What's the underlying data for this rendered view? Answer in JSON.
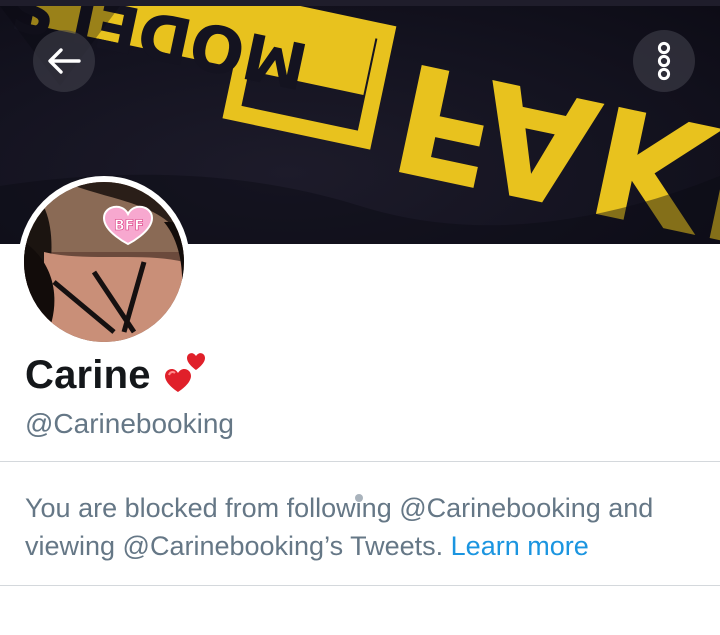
{
  "profile": {
    "display_name": "Carine",
    "name_emoji": "two-hearts-icon",
    "handle": "@Carinebooking",
    "avatar_badge": "BFF"
  },
  "banner": {
    "label": "FAKE MODELS",
    "colors": {
      "background": "#141320",
      "lettering": "#e8c21e"
    }
  },
  "header": {
    "back_icon": "arrow-left-icon",
    "more_icon": "more-vertical-icon"
  },
  "blocked": {
    "message": "You are blocked from following @Carinebooking and viewing @Carinebooking’s Tweets.",
    "link_label": "Learn more"
  },
  "colors": {
    "text_primary": "#14171a",
    "text_secondary": "#657786",
    "link": "#1b95e0",
    "heart": "#e0202a"
  }
}
